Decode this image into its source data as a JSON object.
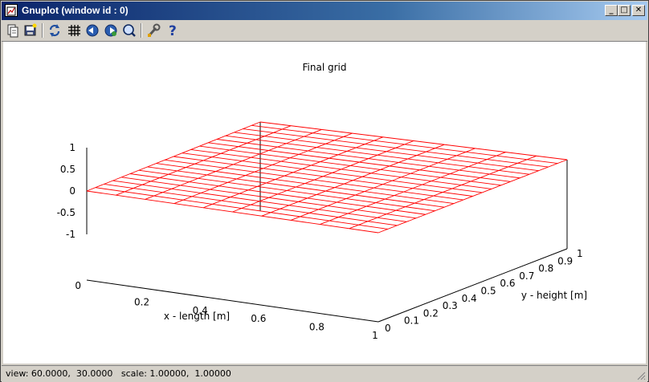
{
  "window": {
    "title": "Gnuplot (window id : 0)",
    "controls": {
      "minimize": "_",
      "maximize": "□",
      "close": "✕"
    }
  },
  "toolbar": {
    "buttons": [
      {
        "name": "copy-to-clipboard",
        "icon": "clipboard-icon"
      },
      {
        "name": "print",
        "icon": "print-icon"
      },
      {
        "name": "replot",
        "icon": "refresh-icon"
      },
      {
        "name": "toggle-grid",
        "icon": "grid-icon"
      },
      {
        "name": "zoom-previous",
        "icon": "zoom-previous-icon"
      },
      {
        "name": "zoom-next",
        "icon": "zoom-next-icon"
      },
      {
        "name": "autoscale",
        "icon": "autoscale-icon"
      },
      {
        "name": "options",
        "icon": "wrench-icon"
      },
      {
        "name": "help",
        "icon": "help-icon"
      }
    ]
  },
  "statusbar": {
    "text": "view: 60.0000,  30.0000   scale: 1.00000,  1.00000"
  },
  "chart_data": {
    "type": "surface",
    "title": "Final grid",
    "xlabel": "x - length [m]",
    "ylabel": "y - height [m]",
    "xlim": [
      0,
      1
    ],
    "ylim": [
      0,
      1
    ],
    "zlim": [
      -1,
      1
    ],
    "xticks": [
      "0.2",
      "0.4",
      "0.6",
      "0.8",
      "1"
    ],
    "yticks": [
      "0",
      "0.1",
      "0.2",
      "0.3",
      "0.4",
      "0.5",
      "0.6",
      "0.7",
      "0.8",
      "0.9",
      "1"
    ],
    "zticks": [
      "1",
      "0.5",
      "0",
      "-0.5",
      "-1"
    ],
    "zbase_label": "0",
    "grid_lines_x": 11,
    "grid_lines_y": 21,
    "surface_z": 0,
    "line_color": "#ff0000",
    "view": [
      60,
      30
    ]
  }
}
